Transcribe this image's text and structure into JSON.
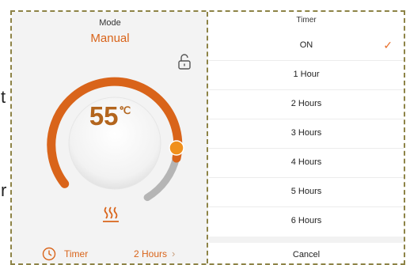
{
  "background": {
    "glyph_top": "t",
    "glyph_bottom": "r"
  },
  "left_panel": {
    "mode_label": "Mode",
    "mode_value": "Manual",
    "lock_icon": "unlock-icon",
    "temperature": "55",
    "temperature_unit": "℃",
    "heat_icon": "heat-waves-icon",
    "timer_label": "Timer",
    "timer_value": "2 Hours",
    "timer_chevron": "›",
    "colors": {
      "accent": "#d9641a",
      "track": "#b5b5b5",
      "knob": "#f0901c"
    }
  },
  "timer_sheet": {
    "title": "Timer",
    "options": [
      {
        "label": "ON",
        "selected": true
      },
      {
        "label": "1 Hour",
        "selected": false
      },
      {
        "label": "2 Hours",
        "selected": false
      },
      {
        "label": "3 Hours",
        "selected": false
      },
      {
        "label": "4 Hours",
        "selected": false
      },
      {
        "label": "5 Hours",
        "selected": false
      },
      {
        "label": "6 Hours",
        "selected": false
      }
    ],
    "check_mark": "✓",
    "cancel_label": "Cancel"
  }
}
